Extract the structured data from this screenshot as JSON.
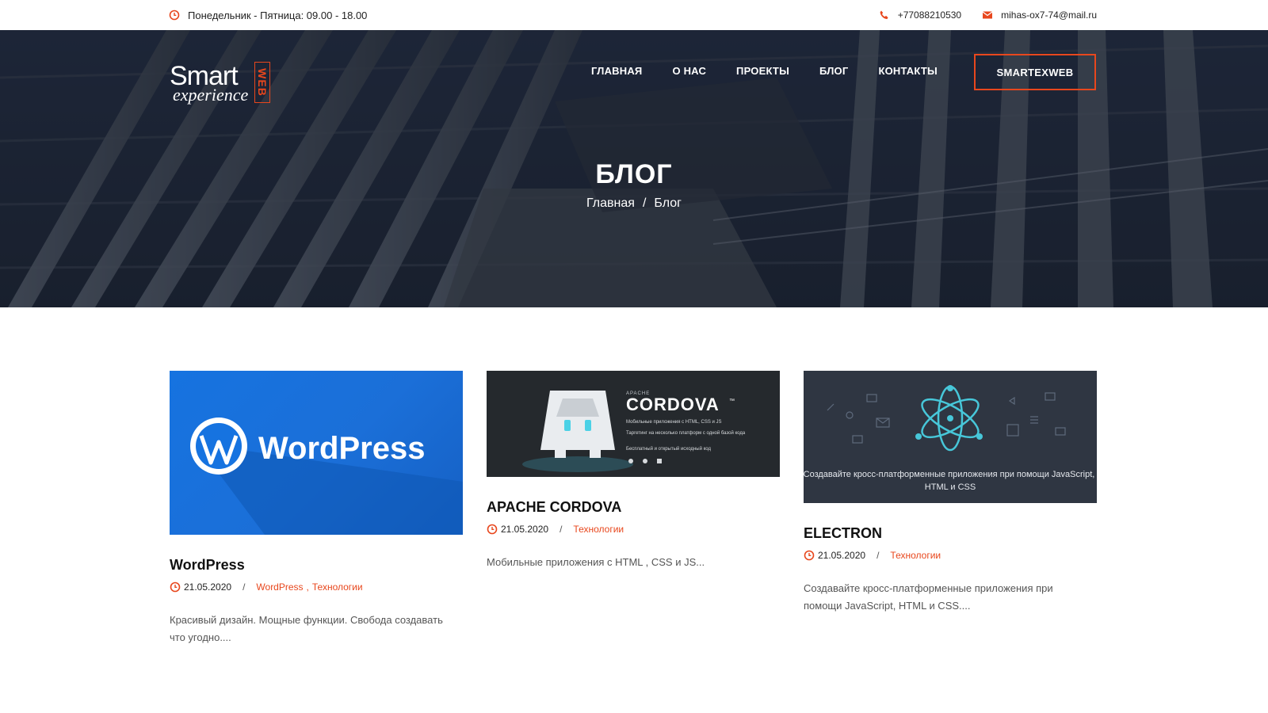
{
  "topbar": {
    "hours": "Понедельник - Пятница: 09.00 - 18.00",
    "phone": "+77088210530",
    "email": "mihas-ox7-74@mail.ru"
  },
  "logo": {
    "line1": "Smart",
    "line2": "experience",
    "badge": "WEB"
  },
  "nav": {
    "items": [
      "ГЛАВНАЯ",
      "О НАС",
      "ПРОЕКТЫ",
      "БЛОГ",
      "КОНТАКТЫ"
    ],
    "cta": "SMARTEXWEB"
  },
  "hero": {
    "title": "БЛОГ",
    "breadcrumb": [
      "Главная",
      "Блог"
    ],
    "separator": "/"
  },
  "posts": [
    {
      "image_text": "WordPress",
      "title": "WordPress",
      "date": "21.05.2020",
      "categories": [
        "WordPress",
        "Технологии"
      ],
      "excerpt": "Красивый дизайн. Мощные функции. Свобода создавать что угодно...."
    },
    {
      "image_text": {
        "brand_small": "APACHE",
        "brand": "CORDOVA",
        "tm": "™",
        "line1": "Мобильные приложения с HTML, CSS и JS",
        "line2": "Таргетинг на несколько платформ с одной базой кода",
        "line3": "Бесплатный и открытый исходный код"
      },
      "title": "APACHE CORDOVA",
      "date": "21.05.2020",
      "categories": [
        "Технологии"
      ],
      "excerpt": "Мобильные приложения с HTML , CSS и JS..."
    },
    {
      "image_text": "Создавайте кросс-платформенные приложения при помощи JavaScript, HTML и CSS",
      "title": "ELECTRON",
      "date": "21.05.2020",
      "categories": [
        "Технологии"
      ],
      "excerpt": "Создавайте кросс-платформенные приложения при помощи JavaScript, HTML и CSS...."
    }
  ],
  "colors": {
    "accent": "#e8471d",
    "wordpress_blue": "#1673e0",
    "electron_teal": "#47c7d9"
  },
  "icons": {
    "clock": "clock-icon",
    "phone": "phone-icon",
    "mail": "envelope-icon"
  }
}
